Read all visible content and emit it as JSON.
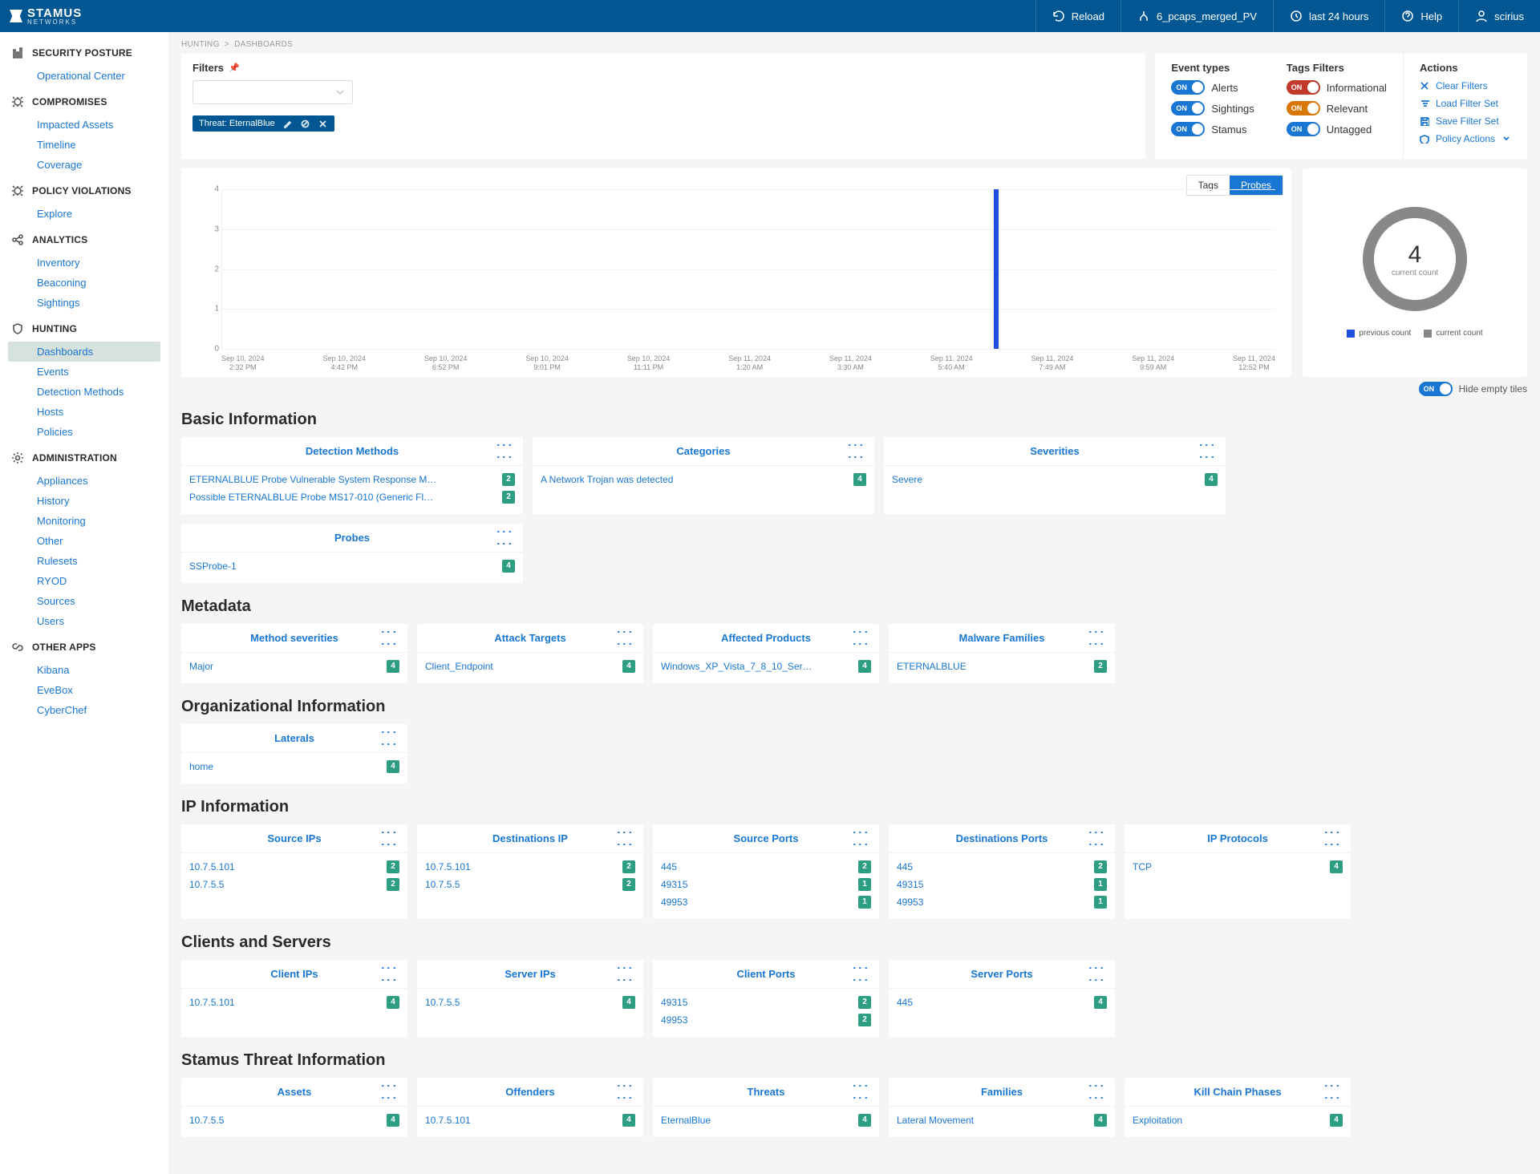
{
  "brand": {
    "name": "STAMUS",
    "sub": "NETWORKS"
  },
  "header": {
    "reload": "Reload",
    "source": "6_pcaps_merged_PV",
    "timerange": "last 24 hours",
    "help": "Help",
    "user": "scirius"
  },
  "nav": {
    "groups": [
      {
        "label": "SECURITY POSTURE",
        "icon": "bars",
        "items": [
          "Operational Center"
        ]
      },
      {
        "label": "COMPROMISES",
        "icon": "bug",
        "items": [
          "Impacted Assets",
          "Timeline",
          "Coverage"
        ]
      },
      {
        "label": "POLICY VIOLATIONS",
        "icon": "bug",
        "items": [
          "Explore"
        ]
      },
      {
        "label": "ANALYTICS",
        "icon": "share",
        "items": [
          "Inventory",
          "Beaconing",
          "Sightings"
        ]
      },
      {
        "label": "HUNTING",
        "icon": "shield",
        "items": [
          "Dashboards",
          "Events",
          "Detection Methods",
          "Hosts",
          "Policies"
        ]
      },
      {
        "label": "ADMINISTRATION",
        "icon": "gear",
        "items": [
          "Appliances",
          "History",
          "Monitoring",
          "Other",
          "Rulesets",
          "RYOD",
          "Sources",
          "Users"
        ]
      },
      {
        "label": "OTHER APPS",
        "icon": "link",
        "items": [
          "Kibana",
          "EveBox",
          "CyberChef"
        ]
      }
    ],
    "active": "Dashboards"
  },
  "breadcrumb": [
    "HUNTING",
    "DASHBOARDS"
  ],
  "filters": {
    "title": "Filters",
    "chip": "Threat: EternalBlue"
  },
  "event_types": {
    "title": "Event types",
    "items": [
      {
        "label": "Alerts",
        "color": "blue"
      },
      {
        "label": "Sightings",
        "color": "blue"
      },
      {
        "label": "Stamus",
        "color": "blue"
      }
    ]
  },
  "tags_filters": {
    "title": "Tags Filters",
    "items": [
      {
        "label": "Informational",
        "color": "red"
      },
      {
        "label": "Relevant",
        "color": "orange"
      },
      {
        "label": "Untagged",
        "color": "blue"
      }
    ]
  },
  "actions": {
    "title": "Actions",
    "items": [
      "Clear Filters",
      "Load Filter Set",
      "Save Filter Set",
      "Policy Actions"
    ]
  },
  "chart_tabs": {
    "tags": "Tags",
    "probes": "Probes"
  },
  "chart_data": {
    "type": "bar",
    "ylim": [
      0,
      4
    ],
    "yticks": [
      0,
      1,
      2,
      3,
      4
    ],
    "categories": [
      "Sep 10, 2024\n2:32 PM",
      "Sep 10, 2024\n4:42 PM",
      "Sep 10, 2024\n6:52 PM",
      "Sep 10, 2024\n9:01 PM",
      "Sep 10, 2024\n11:11 PM",
      "Sep 11, 2024\n1:20 AM",
      "Sep 11, 2024\n3:30 AM",
      "Sep 11, 2024\n5:40 AM",
      "Sep 11, 2024\n7:49 AM",
      "Sep 11, 2024\n9:59 AM",
      "Sep 11, 2024\n12:52 PM"
    ],
    "bars": [
      {
        "index": 7.35,
        "value": 4
      }
    ],
    "donut": {
      "value": "4",
      "label": "current count"
    },
    "legend": {
      "prev": "previous count",
      "curr": "current count",
      "prev_color": "#1f4ee0",
      "curr_color": "#888"
    }
  },
  "hide_empty": "Hide empty tiles",
  "toggle_on": "ON",
  "sections": [
    {
      "title": "Basic Information",
      "tiles": [
        {
          "w": "wide",
          "title": "Detection Methods",
          "rows": [
            {
              "label": "ETERNALBLUE Probe Vulnerable System Response M…",
              "count": 2
            },
            {
              "label": "Possible ETERNALBLUE Probe MS17-010 (Generic Fl…",
              "count": 2
            }
          ]
        },
        {
          "w": "wide",
          "title": "Categories",
          "rows": [
            {
              "label": "A Network Trojan was detected",
              "count": 4
            }
          ]
        },
        {
          "w": "wide",
          "title": "Severities",
          "rows": [
            {
              "label": "Severe",
              "count": 4
            }
          ]
        },
        {
          "w": "wide",
          "title": "Probes",
          "rows": [
            {
              "label": "SSProbe-1",
              "count": 4
            }
          ]
        }
      ]
    },
    {
      "title": "Metadata",
      "tiles": [
        {
          "title": "Method severities",
          "rows": [
            {
              "label": "Major",
              "count": 4
            }
          ]
        },
        {
          "title": "Attack Targets",
          "rows": [
            {
              "label": "Client_Endpoint",
              "count": 4
            }
          ]
        },
        {
          "title": "Affected Products",
          "rows": [
            {
              "label": "Windows_XP_Vista_7_8_10_Ser…",
              "count": 4
            }
          ]
        },
        {
          "title": "Malware Families",
          "rows": [
            {
              "label": "ETERNALBLUE",
              "count": 2
            }
          ]
        }
      ]
    },
    {
      "title": "Organizational Information",
      "tiles": [
        {
          "title": "Laterals",
          "rows": [
            {
              "label": "home",
              "count": 4
            }
          ]
        }
      ]
    },
    {
      "title": "IP Information",
      "tiles": [
        {
          "title": "Source IPs",
          "rows": [
            {
              "label": "10.7.5.101",
              "count": 2
            },
            {
              "label": "10.7.5.5",
              "count": 2
            }
          ]
        },
        {
          "title": "Destinations IP",
          "rows": [
            {
              "label": "10.7.5.101",
              "count": 2
            },
            {
              "label": "10.7.5.5",
              "count": 2
            }
          ]
        },
        {
          "title": "Source Ports",
          "rows": [
            {
              "label": "445",
              "count": 2
            },
            {
              "label": "49315",
              "count": 1
            },
            {
              "label": "49953",
              "count": 1
            }
          ]
        },
        {
          "title": "Destinations Ports",
          "rows": [
            {
              "label": "445",
              "count": 2
            },
            {
              "label": "49315",
              "count": 1
            },
            {
              "label": "49953",
              "count": 1
            }
          ]
        },
        {
          "title": "IP Protocols",
          "rows": [
            {
              "label": "TCP",
              "count": 4
            }
          ]
        }
      ]
    },
    {
      "title": "Clients and Servers",
      "tiles": [
        {
          "title": "Client IPs",
          "rows": [
            {
              "label": "10.7.5.101",
              "count": 4
            }
          ]
        },
        {
          "title": "Server IPs",
          "rows": [
            {
              "label": "10.7.5.5",
              "count": 4
            }
          ]
        },
        {
          "title": "Client Ports",
          "rows": [
            {
              "label": "49315",
              "count": 2
            },
            {
              "label": "49953",
              "count": 2
            }
          ]
        },
        {
          "title": "Server Ports",
          "rows": [
            {
              "label": "445",
              "count": 4
            }
          ]
        }
      ]
    },
    {
      "title": "Stamus Threat Information",
      "tiles": [
        {
          "title": "Assets",
          "rows": [
            {
              "label": "10.7.5.5",
              "count": 4
            }
          ]
        },
        {
          "title": "Offenders",
          "rows": [
            {
              "label": "10.7.5.101",
              "count": 4
            }
          ]
        },
        {
          "title": "Threats",
          "rows": [
            {
              "label": "EternalBlue",
              "count": 4
            }
          ]
        },
        {
          "title": "Families",
          "rows": [
            {
              "label": "Lateral Movement",
              "count": 4
            }
          ]
        },
        {
          "title": "Kill Chain Phases",
          "rows": [
            {
              "label": "Exploitation",
              "count": 4
            }
          ]
        }
      ]
    }
  ]
}
